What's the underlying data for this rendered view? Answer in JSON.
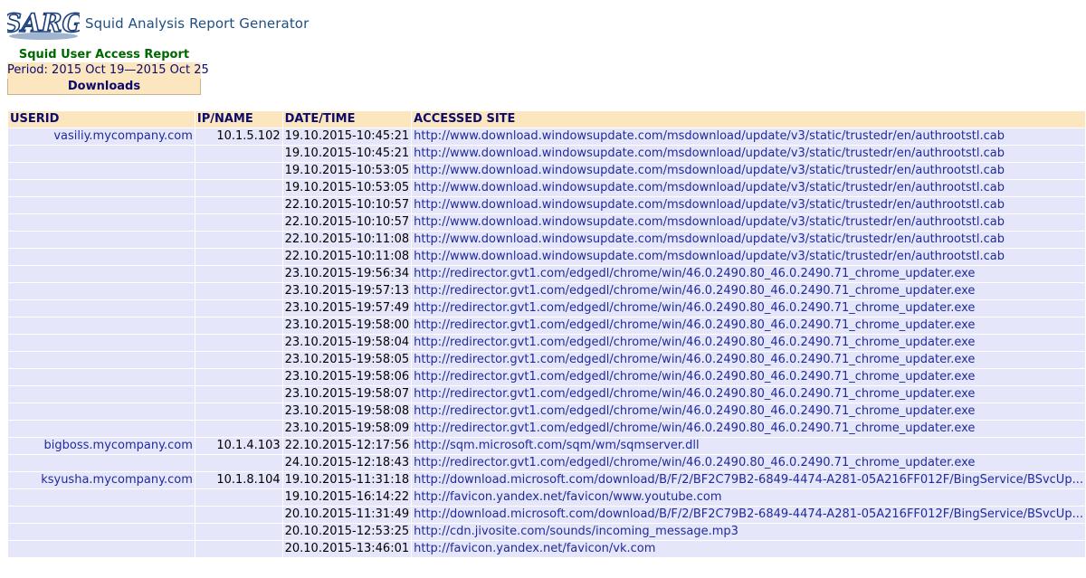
{
  "app": {
    "logo_text": "SARG",
    "title": "Squid Analysis Report Generator"
  },
  "report": {
    "title": "Squid User Access Report",
    "period": "Period: 2015 Oct 19—2015 Oct 25",
    "type": "Downloads"
  },
  "table": {
    "headers": {
      "userid": "USERID",
      "ip": "IP/NAME",
      "datetime": "DATE/TIME",
      "site": "ACCESSED SITE"
    },
    "rows": [
      {
        "user": "vasiliy.mycompany.com",
        "ip": "10.1.5.102",
        "datetime": "19.10.2015-10:45:21",
        "site": "http://www.download.windowsupdate.com/msdownload/update/v3/static/trustedr/en/authrootstl.cab"
      },
      {
        "user": "",
        "ip": "",
        "datetime": "19.10.2015-10:45:21",
        "site": "http://www.download.windowsupdate.com/msdownload/update/v3/static/trustedr/en/authrootstl.cab"
      },
      {
        "user": "",
        "ip": "",
        "datetime": "19.10.2015-10:53:05",
        "site": "http://www.download.windowsupdate.com/msdownload/update/v3/static/trustedr/en/authrootstl.cab"
      },
      {
        "user": "",
        "ip": "",
        "datetime": "19.10.2015-10:53:05",
        "site": "http://www.download.windowsupdate.com/msdownload/update/v3/static/trustedr/en/authrootstl.cab"
      },
      {
        "user": "",
        "ip": "",
        "datetime": "22.10.2015-10:10:57",
        "site": "http://www.download.windowsupdate.com/msdownload/update/v3/static/trustedr/en/authrootstl.cab"
      },
      {
        "user": "",
        "ip": "",
        "datetime": "22.10.2015-10:10:57",
        "site": "http://www.download.windowsupdate.com/msdownload/update/v3/static/trustedr/en/authrootstl.cab"
      },
      {
        "user": "",
        "ip": "",
        "datetime": "22.10.2015-10:11:08",
        "site": "http://www.download.windowsupdate.com/msdownload/update/v3/static/trustedr/en/authrootstl.cab"
      },
      {
        "user": "",
        "ip": "",
        "datetime": "22.10.2015-10:11:08",
        "site": "http://www.download.windowsupdate.com/msdownload/update/v3/static/trustedr/en/authrootstl.cab"
      },
      {
        "user": "",
        "ip": "",
        "datetime": "23.10.2015-19:56:34",
        "site": "http://redirector.gvt1.com/edgedl/chrome/win/46.0.2490.80_46.0.2490.71_chrome_updater.exe"
      },
      {
        "user": "",
        "ip": "",
        "datetime": "23.10.2015-19:57:13",
        "site": "http://redirector.gvt1.com/edgedl/chrome/win/46.0.2490.80_46.0.2490.71_chrome_updater.exe"
      },
      {
        "user": "",
        "ip": "",
        "datetime": "23.10.2015-19:57:49",
        "site": "http://redirector.gvt1.com/edgedl/chrome/win/46.0.2490.80_46.0.2490.71_chrome_updater.exe"
      },
      {
        "user": "",
        "ip": "",
        "datetime": "23.10.2015-19:58:00",
        "site": "http://redirector.gvt1.com/edgedl/chrome/win/46.0.2490.80_46.0.2490.71_chrome_updater.exe"
      },
      {
        "user": "",
        "ip": "",
        "datetime": "23.10.2015-19:58:04",
        "site": "http://redirector.gvt1.com/edgedl/chrome/win/46.0.2490.80_46.0.2490.71_chrome_updater.exe"
      },
      {
        "user": "",
        "ip": "",
        "datetime": "23.10.2015-19:58:05",
        "site": "http://redirector.gvt1.com/edgedl/chrome/win/46.0.2490.80_46.0.2490.71_chrome_updater.exe"
      },
      {
        "user": "",
        "ip": "",
        "datetime": "23.10.2015-19:58:06",
        "site": "http://redirector.gvt1.com/edgedl/chrome/win/46.0.2490.80_46.0.2490.71_chrome_updater.exe"
      },
      {
        "user": "",
        "ip": "",
        "datetime": "23.10.2015-19:58:07",
        "site": "http://redirector.gvt1.com/edgedl/chrome/win/46.0.2490.80_46.0.2490.71_chrome_updater.exe"
      },
      {
        "user": "",
        "ip": "",
        "datetime": "23.10.2015-19:58:08",
        "site": "http://redirector.gvt1.com/edgedl/chrome/win/46.0.2490.80_46.0.2490.71_chrome_updater.exe"
      },
      {
        "user": "",
        "ip": "",
        "datetime": "23.10.2015-19:58:09",
        "site": "http://redirector.gvt1.com/edgedl/chrome/win/46.0.2490.80_46.0.2490.71_chrome_updater.exe"
      },
      {
        "user": "bigboss.mycompany.com",
        "ip": "10.1.4.103",
        "datetime": "22.10.2015-12:17:56",
        "site": "http://sqm.microsoft.com/sqm/wm/sqmserver.dll"
      },
      {
        "user": "",
        "ip": "",
        "datetime": "24.10.2015-12:18:43",
        "site": "http://redirector.gvt1.com/edgedl/chrome/win/46.0.2490.80_46.0.2490.71_chrome_updater.exe"
      },
      {
        "user": "ksyusha.mycompany.com",
        "ip": "10.1.8.104",
        "datetime": "19.10.2015-11:31:18",
        "site": "http://download.microsoft.com/download/B/F/2/BF2C79B2-6849-4474-A281-05A216FF012F/BingService/BSvcUp..."
      },
      {
        "user": "",
        "ip": "",
        "datetime": "19.10.2015-16:14:22",
        "site": "http://favicon.yandex.net/favicon/www.youtube.com"
      },
      {
        "user": "",
        "ip": "",
        "datetime": "20.10.2015-11:31:49",
        "site": "http://download.microsoft.com/download/B/F/2/BF2C79B2-6849-4474-A281-05A216FF012F/BingService/BSvcUp..."
      },
      {
        "user": "",
        "ip": "",
        "datetime": "20.10.2015-12:53:25",
        "site": "http://cdn.jivosite.com/sounds/incoming_message.mp3"
      },
      {
        "user": "",
        "ip": "",
        "datetime": "20.10.2015-13:46:01",
        "site": "http://favicon.yandex.net/favicon/vk.com"
      }
    ]
  }
}
